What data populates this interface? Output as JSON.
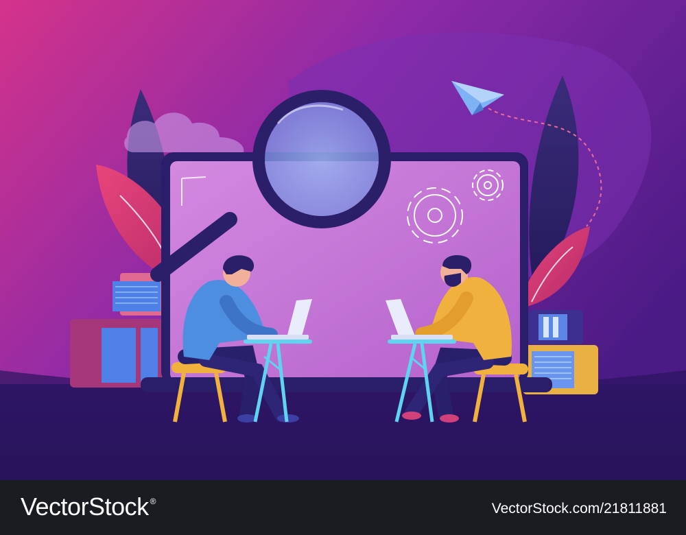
{
  "footer": {
    "brand_text": "VectorStock",
    "brand_mark": "®",
    "image_id_text": "VectorStock.com/21811881"
  },
  "illustration": {
    "subject": "two men working on laptops in front of a large laptop with magnifying glass and gears",
    "icons": [
      "magnifying-glass-icon",
      "gear-icon",
      "paper-plane-icon",
      "cloud-icon",
      "book-stack-icon",
      "leaf-icon"
    ]
  },
  "colors": {
    "bg_top_left": "#d4338a",
    "bg_mid": "#8d2aa8",
    "bg_right": "#4a1a85",
    "floor": "#2a145e",
    "screen_fill": "#c879d9",
    "man_left_shirt": "#4e8ee0",
    "man_right_shirt": "#f0b13f",
    "footer_bg": "#1b1c22"
  }
}
